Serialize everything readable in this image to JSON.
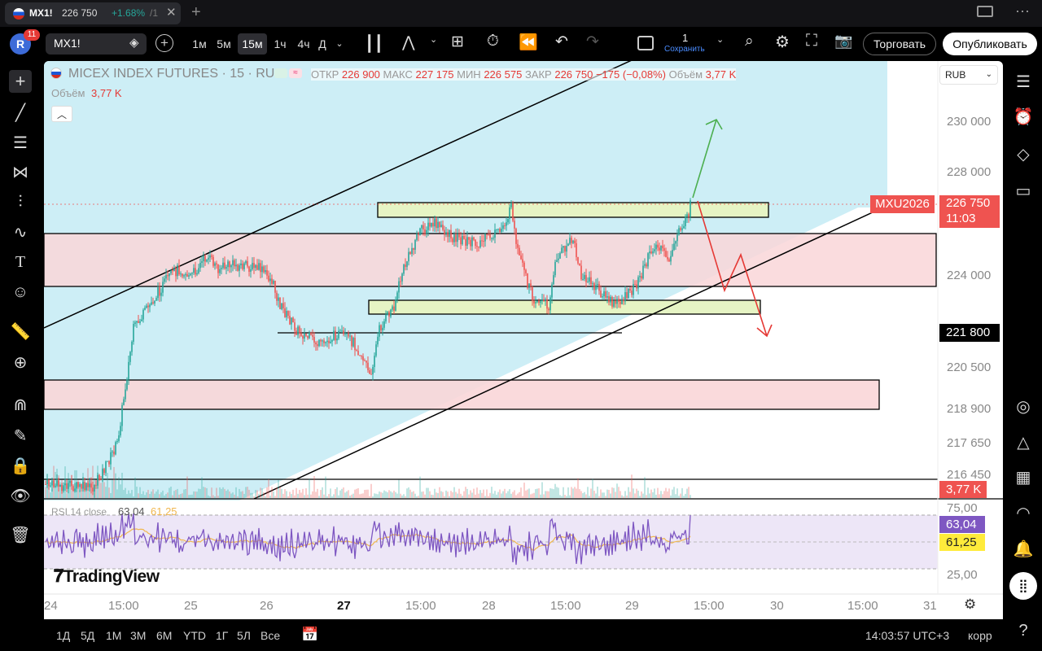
{
  "tab": {
    "ticker": "MX1!",
    "price": "226 750",
    "change": "+1.68%",
    "rest": "/1"
  },
  "toolbar": {
    "avatar": "R",
    "badge": "11",
    "symbol": "MX1!",
    "intervals": [
      "1м",
      "5м",
      "15м",
      "1ч",
      "4ч",
      "Д"
    ],
    "layout_count": "1",
    "save_label": "Сохранить",
    "trade_label": "Торговать",
    "publish_label": "Опубликовать"
  },
  "legend": {
    "name": "MICEX INDEX FUTURES · 15 · RUS",
    "open_label": "ОТКР",
    "open": "226 900",
    "high_label": "МАКС",
    "high": "227 175",
    "low_label": "МИН",
    "low": "226 575",
    "close_label": "ЗАКР",
    "close": "226 750",
    "change": "−175 (−0,08%)",
    "vol_label": "Объём",
    "vol": "3,77 K",
    "vol2_label": "Объём",
    "vol2": "3,77 K"
  },
  "currency": "RUB",
  "price_axis": [
    "230 000",
    "228 000",
    "224 000",
    "220 500",
    "218 900",
    "217 650",
    "216 450"
  ],
  "price_badges": {
    "contract": "MXU2026",
    "last": "226 750",
    "countdown": "11:03",
    "level": "221 800",
    "volume": "3,77 K"
  },
  "rsi": {
    "label": "RSI 14 close",
    "value": "63,04",
    "ma": "61,25",
    "upper": "75,00",
    "lower": "25,00"
  },
  "time_axis": [
    "24",
    "15:00",
    "25",
    "26",
    "27",
    "15:00",
    "28",
    "15:00",
    "29",
    "15:00",
    "30",
    "15:00",
    "31"
  ],
  "watermark": "TradingView",
  "ranges": [
    "1Д",
    "5Д",
    "1М",
    "3М",
    "6М",
    "YTD",
    "1Г",
    "5Л",
    "Все"
  ],
  "clock": "14:03:57 UTC+3",
  "corr_label": "корр",
  "colors": {
    "up": "#26a69a",
    "down": "#ef5350",
    "channel": "#cdeef6",
    "zone_red": "#f9d6d8",
    "zone_green": "#e6f4c4",
    "rsi_bg": "#ede6f7",
    "rsi_line": "#7e57c2",
    "rsi_ma": "#f0b74f",
    "arrow_up": "#4caf50",
    "arrow_down": "#e53935"
  }
}
